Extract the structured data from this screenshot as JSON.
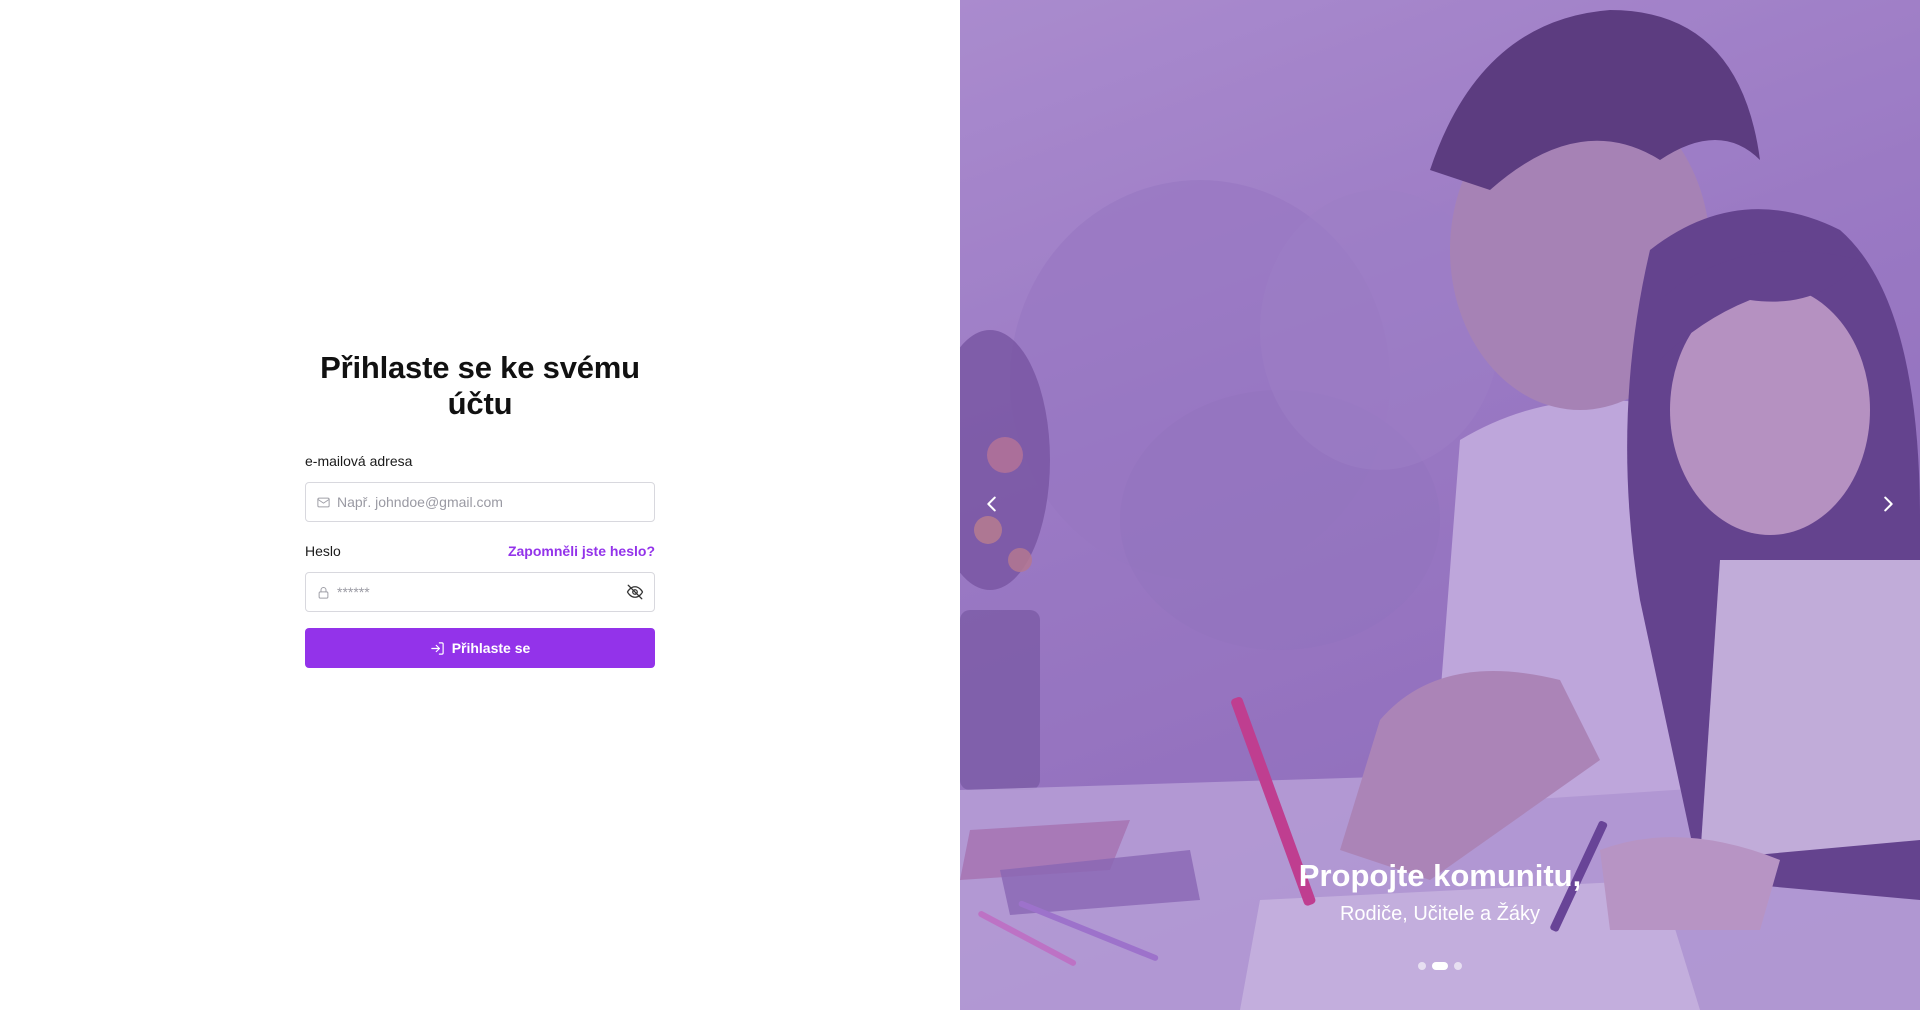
{
  "login": {
    "title": "Přihlaste se ke svému účtu",
    "email_label": "e-mailová adresa",
    "email_placeholder": "Např. johndoe@gmail.com",
    "password_label": "Heslo",
    "forgot_link": "Zapomněli jste heslo?",
    "password_placeholder": "******",
    "submit_label": "Přihlaste se"
  },
  "hero": {
    "title": "Propojte komunitu,",
    "subtitle": "Rodiče, Učitele a Žáky",
    "slide_count": 3,
    "active_slide": 2
  },
  "colors": {
    "accent": "#9333ea",
    "overlay": "#8a5cbe"
  },
  "icons": {
    "email": "mail-icon",
    "password": "lock-icon",
    "toggle_password": "eye-off-icon",
    "submit": "log-in-icon",
    "prev": "chevron-left-icon",
    "next": "chevron-right-icon"
  }
}
